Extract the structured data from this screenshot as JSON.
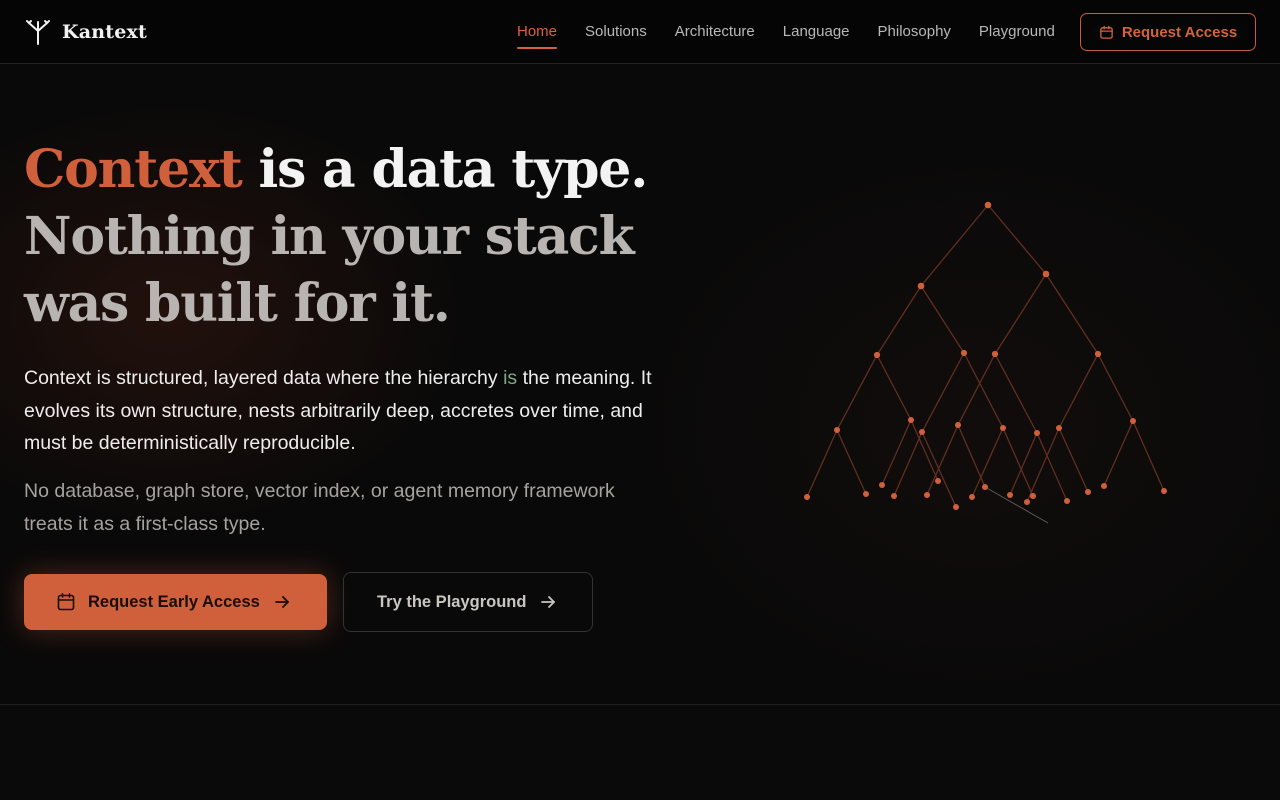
{
  "brand": {
    "name": "Kantext",
    "logo_icon": "trident-branch-icon"
  },
  "nav": {
    "items": [
      {
        "label": "Home",
        "active": true
      },
      {
        "label": "Solutions",
        "active": false
      },
      {
        "label": "Architecture",
        "active": false
      },
      {
        "label": "Language",
        "active": false
      },
      {
        "label": "Philosophy",
        "active": false
      },
      {
        "label": "Playground",
        "active": false
      }
    ],
    "request_access": {
      "label": "Request Access",
      "icon": "calendar-icon"
    }
  },
  "hero": {
    "headline": {
      "accent": "Context",
      "line1_rest": " is a data type.",
      "line2": "Nothing in your stack",
      "line3": "was built for it."
    },
    "lead": {
      "before": "Context is structured, layered data where the hierarchy ",
      "emphasis": "is",
      "after": " the meaning. It evolves its own structure, nests arbitrarily deep, accretes over time, and must be deterministically reproducible."
    },
    "sub": "No database, graph store, vector index, or agent memory framework treats it as a first-class type.",
    "cta_primary": {
      "label": "Request Early Access",
      "icon": "calendar-icon",
      "trailing_icon": "arrow-right-icon"
    },
    "cta_secondary": {
      "label": "Try the Playground",
      "trailing_icon": "arrow-right-icon"
    }
  },
  "colors": {
    "accent": "#d0603c",
    "background": "#0b0a0a",
    "emphasis_green": "#7fa98a"
  }
}
